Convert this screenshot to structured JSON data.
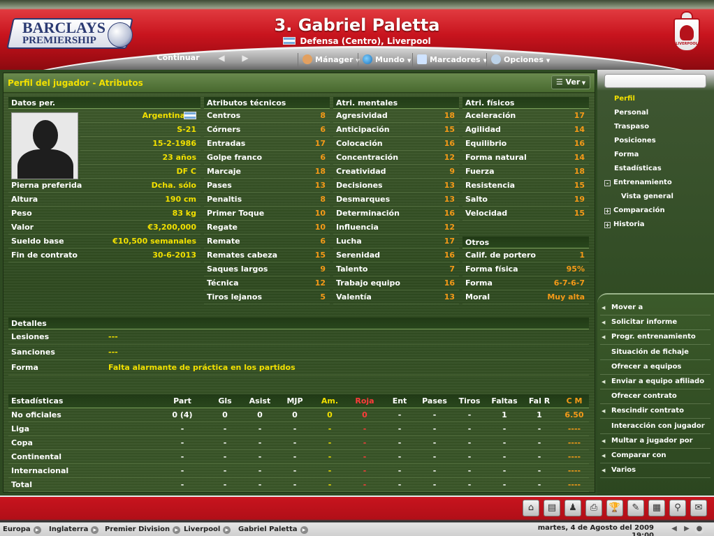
{
  "header": {
    "logo_line1": "BARCLAYS",
    "logo_line2": "PREMIERSHIP",
    "title": "3. Gabriel Paletta",
    "subtitle": "Defensa (Centro), Liverpool",
    "club_crest_text": "LIVERPOOL"
  },
  "menubar": {
    "continue_label": "Continuar",
    "items": [
      {
        "label": "Mánager",
        "icon": "manager-icon"
      },
      {
        "label": "Mundo",
        "icon": "globe-icon"
      },
      {
        "label": "Marcadores",
        "icon": "scores-icon"
      },
      {
        "label": "Opciones",
        "icon": "gear-icon"
      }
    ]
  },
  "panel": {
    "title": "Perfil del jugador - Atributos",
    "view_button": "Ver"
  },
  "personal": {
    "header": "Datos per.",
    "nationality": "Argentina",
    "squad": "S-21",
    "birthdate": "15-2-1986",
    "age": "23 años",
    "position": "DF C",
    "rows": [
      {
        "label": "Pierna preferida",
        "value": "Dcha. sólo"
      },
      {
        "label": "Altura",
        "value": "190 cm"
      },
      {
        "label": "Peso",
        "value": "83 kg"
      },
      {
        "label": "Valor",
        "value": "€3,200,000"
      },
      {
        "label": "Sueldo base",
        "value": "€10,500 semanales"
      },
      {
        "label": "Fin de contrato",
        "value": "30-6-2013"
      }
    ]
  },
  "technical": {
    "header": "Atributos técnicos",
    "rows": [
      {
        "label": "Centros",
        "value": "8"
      },
      {
        "label": "Córners",
        "value": "6"
      },
      {
        "label": "Entradas",
        "value": "17"
      },
      {
        "label": "Golpe franco",
        "value": "6"
      },
      {
        "label": "Marcaje",
        "value": "18"
      },
      {
        "label": "Pases",
        "value": "13"
      },
      {
        "label": "Penaltis",
        "value": "8"
      },
      {
        "label": "Primer Toque",
        "value": "10"
      },
      {
        "label": "Regate",
        "value": "10"
      },
      {
        "label": "Remate",
        "value": "6"
      },
      {
        "label": "Remates cabeza",
        "value": "15"
      },
      {
        "label": "Saques largos",
        "value": "9"
      },
      {
        "label": "Técnica",
        "value": "12"
      },
      {
        "label": "Tiros lejanos",
        "value": "5"
      }
    ]
  },
  "mental": {
    "header": "Atri. mentales",
    "rows": [
      {
        "label": "Agresividad",
        "value": "18"
      },
      {
        "label": "Anticipación",
        "value": "15"
      },
      {
        "label": "Colocación",
        "value": "16"
      },
      {
        "label": "Concentración",
        "value": "12"
      },
      {
        "label": "Creatividad",
        "value": "9"
      },
      {
        "label": "Decisiones",
        "value": "13"
      },
      {
        "label": "Desmarques",
        "value": "13"
      },
      {
        "label": "Determinación",
        "value": "16"
      },
      {
        "label": "Influencia",
        "value": "12"
      },
      {
        "label": "Lucha",
        "value": "17"
      },
      {
        "label": "Serenidad",
        "value": "16"
      },
      {
        "label": "Talento",
        "value": "7"
      },
      {
        "label": "Trabajo equipo",
        "value": "16"
      },
      {
        "label": "Valentía",
        "value": "13"
      }
    ]
  },
  "physical": {
    "header": "Atri. físicos",
    "rows": [
      {
        "label": "Aceleración",
        "value": "17"
      },
      {
        "label": "Agilidad",
        "value": "14"
      },
      {
        "label": "Equilibrio",
        "value": "16"
      },
      {
        "label": "Forma natural",
        "value": "14"
      },
      {
        "label": "Fuerza",
        "value": "18"
      },
      {
        "label": "Resistencia",
        "value": "15"
      },
      {
        "label": "Salto",
        "value": "19"
      },
      {
        "label": "Velocidad",
        "value": "15"
      }
    ]
  },
  "others": {
    "header": "Otros",
    "rows": [
      {
        "label": "Calif. de portero",
        "value": "1"
      },
      {
        "label": "Forma física",
        "value": "95%"
      },
      {
        "label": "Forma",
        "value": "6-7-6-7"
      },
      {
        "label": "Moral",
        "value": "Muy alta"
      }
    ]
  },
  "details": {
    "header": "Detalles",
    "rows": [
      {
        "label": "Lesiones",
        "value": "---"
      },
      {
        "label": "Sanciones",
        "value": "---"
      },
      {
        "label": "Forma",
        "value": "Falta alarmante de práctica en los partidos"
      }
    ]
  },
  "stats": {
    "header": "Estadísticas",
    "columns": [
      "Part",
      "Gls",
      "Asist",
      "MJP",
      "Am.",
      "Roja",
      "Ent",
      "Pases",
      "Tiros",
      "Faltas",
      "Fal R",
      "C M"
    ],
    "rows": [
      {
        "label": "No oficiales",
        "cells": [
          "0 (4)",
          "0",
          "0",
          "0",
          "0",
          "0",
          "-",
          "-",
          "-",
          "1",
          "1",
          "6.50"
        ]
      },
      {
        "label": "Liga",
        "cells": [
          "-",
          "-",
          "-",
          "-",
          "-",
          "-",
          "-",
          "-",
          "-",
          "-",
          "-",
          "----"
        ]
      },
      {
        "label": "Copa",
        "cells": [
          "-",
          "-",
          "-",
          "-",
          "-",
          "-",
          "-",
          "-",
          "-",
          "-",
          "-",
          "----"
        ]
      },
      {
        "label": "Continental",
        "cells": [
          "-",
          "-",
          "-",
          "-",
          "-",
          "-",
          "-",
          "-",
          "-",
          "-",
          "-",
          "----"
        ]
      },
      {
        "label": "Internacional",
        "cells": [
          "-",
          "-",
          "-",
          "-",
          "-",
          "-",
          "-",
          "-",
          "-",
          "-",
          "-",
          "----"
        ]
      },
      {
        "label": "Total",
        "cells": [
          "-",
          "-",
          "-",
          "-",
          "-",
          "-",
          "-",
          "-",
          "-",
          "-",
          "-",
          "----"
        ]
      }
    ]
  },
  "sidebar": {
    "search_value": "",
    "items": [
      {
        "label": "Perfil",
        "box": ""
      },
      {
        "label": "Personal",
        "box": ""
      },
      {
        "label": "Traspaso",
        "box": ""
      },
      {
        "label": "Posiciones",
        "box": ""
      },
      {
        "label": "Forma",
        "box": ""
      },
      {
        "label": "Estadísticas",
        "box": ""
      },
      {
        "label": "Entrenamiento",
        "box": "-"
      },
      {
        "label": "Vista general",
        "box": ""
      },
      {
        "label": "Comparación",
        "box": "+"
      },
      {
        "label": "Historia",
        "box": "+"
      }
    ],
    "actions": [
      {
        "label": "Mover a",
        "arrow": true
      },
      {
        "label": "Solicitar informe",
        "arrow": true
      },
      {
        "label": "Progr. entrenamiento",
        "arrow": true
      },
      {
        "label": "Situación de fichaje",
        "arrow": false
      },
      {
        "label": "Ofrecer a equipos",
        "arrow": false
      },
      {
        "label": "Enviar a equipo afiliado",
        "arrow": true
      },
      {
        "label": "Ofrecer contrato",
        "arrow": false
      },
      {
        "label": "Rescindir contrato",
        "arrow": true
      },
      {
        "label": "Interacción con jugador",
        "arrow": false
      },
      {
        "label": "Multar a jugador por",
        "arrow": true
      },
      {
        "label": "Comparar con",
        "arrow": true
      },
      {
        "label": "Varios",
        "arrow": true
      }
    ]
  },
  "footer": {
    "toolbar_icons": [
      "home-icon",
      "notebook-icon",
      "tactics-icon",
      "fax-icon",
      "trophy-icon",
      "clipboard-icon",
      "pitch-icon",
      "binoculars-icon",
      "inbox-icon"
    ],
    "breadcrumbs": [
      "Europa",
      "Inglaterra",
      "Premier Division",
      "Liverpool",
      "Gabriel Paletta"
    ],
    "datetime": "martes, 4 de Agosto del 2009 19:00"
  },
  "colors": {
    "accent_yellow": "#f2e000",
    "value_orange": "#f59a18",
    "header_red": "#c8141e",
    "red_card": "#ff3b3b"
  }
}
